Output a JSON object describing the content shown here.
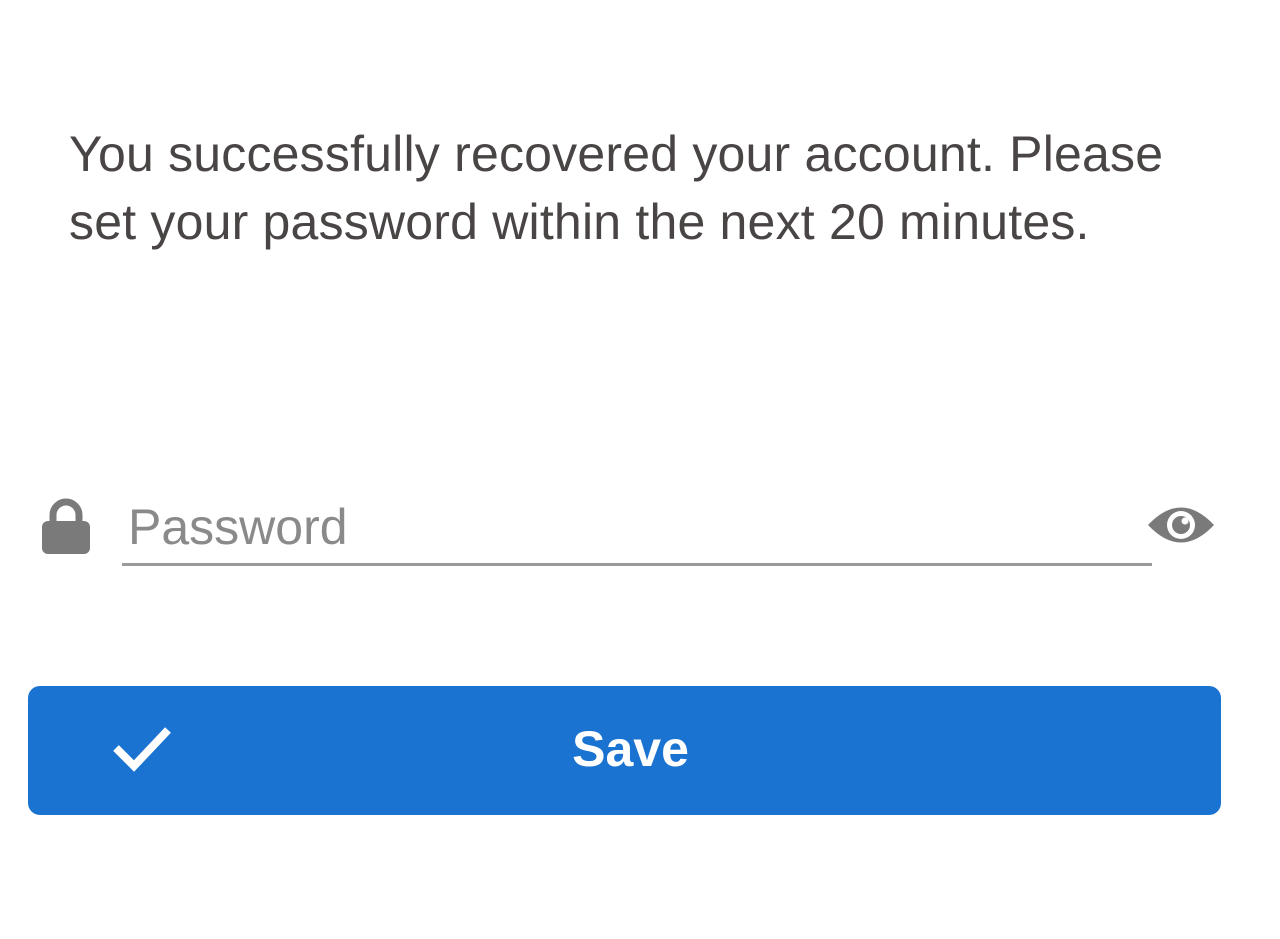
{
  "recovery": {
    "message": "You successfully recovered your account. Please set your password within the next 20 minutes."
  },
  "password_field": {
    "placeholder": "Password",
    "value": "",
    "leading_icon": "lock-icon",
    "trailing_icon": "eye-icon"
  },
  "save_button": {
    "label": "Save",
    "icon": "check-icon"
  },
  "colors": {
    "text": "#4a4545",
    "placeholder": "#8a8a8a",
    "icon": "#7a7a7a",
    "accent": "#1a73d0",
    "button_text": "#ffffff"
  }
}
